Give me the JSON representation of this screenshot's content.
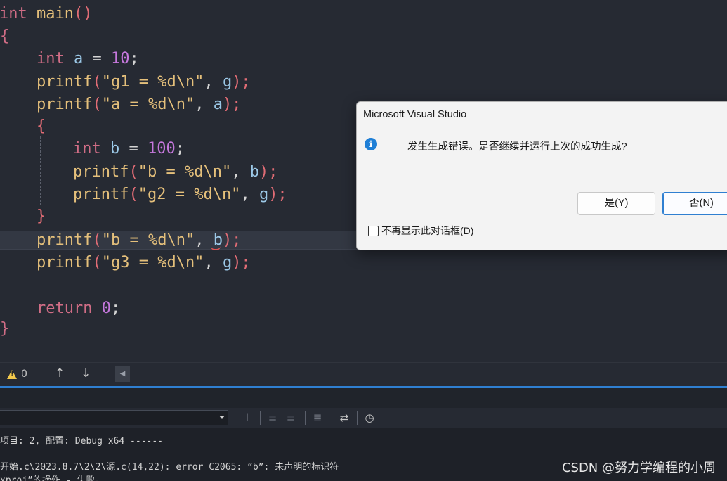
{
  "code": {
    "line1": {
      "kw": "int",
      "fn": "main",
      "p": "()"
    },
    "line2": {
      "brace": "{"
    },
    "line3": {
      "kw": "int",
      "var": "a",
      "op": " = ",
      "num": "10",
      "end": ";"
    },
    "line4": {
      "fn": "printf",
      "open": "(",
      "str": "\"g1 = %d\\n\"",
      "sep": ", ",
      "var": "g",
      "close": ");"
    },
    "line5": {
      "fn": "printf",
      "open": "(",
      "str": "\"a = %d\\n\"",
      "sep": ", ",
      "var": "a",
      "close": ");"
    },
    "line6": {
      "brace": "{"
    },
    "line7": {
      "kw": "int",
      "var": "b",
      "op": " = ",
      "num": "100",
      "end": ";"
    },
    "line8": {
      "fn": "printf",
      "open": "(",
      "str": "\"b = %d\\n\"",
      "sep": ", ",
      "var": "b",
      "close": ");"
    },
    "line9": {
      "fn": "printf",
      "open": "(",
      "str": "\"g2 = %d\\n\"",
      "sep": ", ",
      "var": "g",
      "close": ");"
    },
    "line10": {
      "brace": "}"
    },
    "line11": {
      "fn": "printf",
      "open": "(",
      "str": "\"b = %d\\n\"",
      "sep": ", ",
      "var": "b",
      "close": ");"
    },
    "line12": {
      "fn": "printf",
      "open": "(",
      "str": "\"g3 = %d\\n\"",
      "sep": ", ",
      "var": "g",
      "close": ");"
    },
    "line13": {
      "kw": "return",
      "num": "0",
      "end": ";"
    },
    "line14": {
      "brace": "}"
    }
  },
  "status": {
    "warning_count": "0",
    "up_arrow": "↑",
    "down_arrow": "↓",
    "scroll_left": "◀"
  },
  "output": {
    "line1": "项目: 2, 配置: Debug x64 ------",
    "line2": "开始.c\\2023.8.7\\2\\2\\源.c(14,22): error C2065: “b”: 未声明的标识符",
    "line3": "xproj”的操作 - 失败。"
  },
  "watermark": "CSDN @努力学编程的小周",
  "dialog": {
    "title": "Microsoft Visual Studio",
    "message": "发生生成错误。是否继续并运行上次的成功生成?",
    "yes_label": "是(Y)",
    "no_label": "否(N)",
    "checkbox_label": "不再显示此对话框(D)"
  },
  "icons": {
    "info": "info-icon",
    "warning": "warning-icon"
  },
  "colors": {
    "accent": "#2f7fd1",
    "keyword": "#d16d86",
    "string": "#e5c07b",
    "number": "#c678dd",
    "error": "#e05555"
  }
}
